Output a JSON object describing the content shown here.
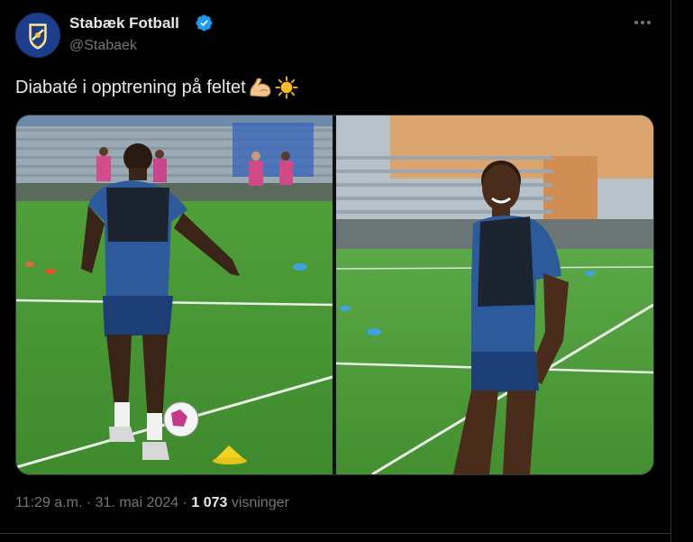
{
  "account": {
    "display_name": "Stabæk Fotball",
    "handle": "@Stabaek",
    "verified": true,
    "brand_color": "#1d3e8a"
  },
  "tweet": {
    "text": "Diabaté i opptrening på feltet",
    "emojis": [
      "flexed-biceps-icon",
      "sun-icon"
    ]
  },
  "media": {
    "count": 2,
    "images": [
      "football-player-passing-photo",
      "football-player-smiling-photo"
    ]
  },
  "meta": {
    "time": "11:29 a.m.",
    "separator": "·",
    "date": "31. mai 2024",
    "views": "1 073",
    "views_label": "visninger"
  },
  "colors": {
    "background": "#000000",
    "text": "#e7e9ea",
    "muted": "#71767b",
    "verified_badge": "#1d9bf0"
  }
}
